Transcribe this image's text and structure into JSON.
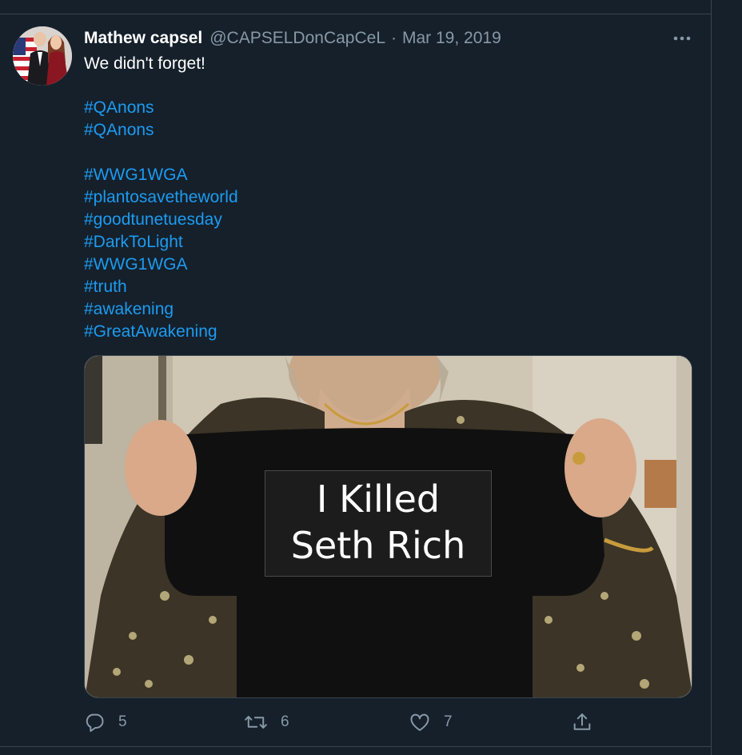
{
  "tweet": {
    "display_name": "Mathew capsel",
    "handle": "@CAPSELDonCapCeL",
    "separator": "·",
    "date": "Mar 19, 2019",
    "text": "We didn't forget!",
    "hashtags": [
      "#QAnons",
      "#QAnons",
      "#WWG1WGA",
      "#plantosavetheworld",
      "#goodtunetuesday",
      "#DarkToLight",
      "#WWG1WGA",
      "#truth",
      "#awakening",
      "#GreatAwakening"
    ],
    "media": {
      "shirt_text_line1": "I Killed",
      "shirt_text_line2": "Seth Rich"
    },
    "actions": {
      "reply_count": "5",
      "retweet_count": "6",
      "like_count": "7"
    }
  },
  "icons": {
    "more": "more-horizontal-icon",
    "reply": "reply-icon",
    "retweet": "retweet-icon",
    "like": "heart-icon",
    "share": "share-icon"
  },
  "colors": {
    "background": "#15202b",
    "border": "#38444d",
    "text_primary": "#ffffff",
    "text_secondary": "#8899a6",
    "link": "#1d9bf0"
  }
}
